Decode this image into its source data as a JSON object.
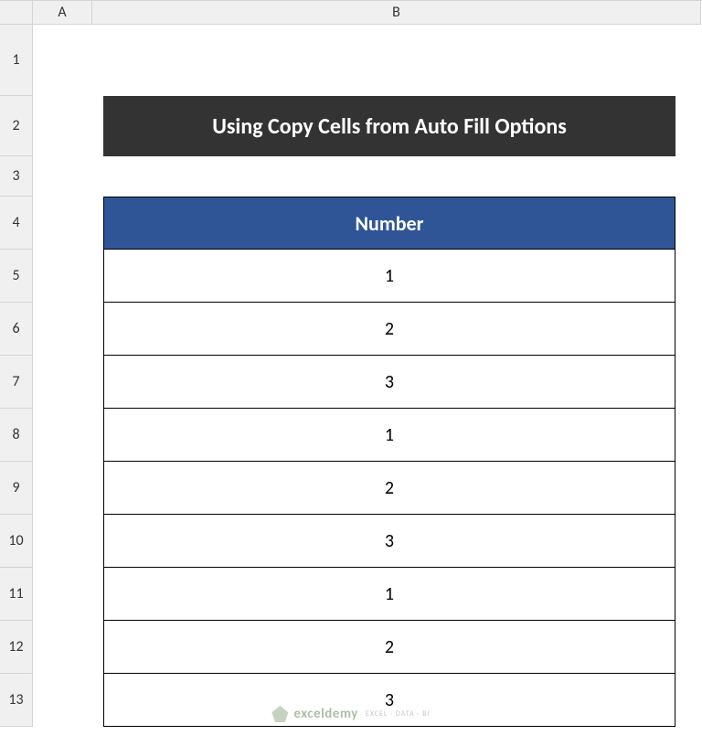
{
  "columns": {
    "corner": "",
    "A": "A",
    "B": "B"
  },
  "rows": [
    "1",
    "2",
    "3",
    "4",
    "5",
    "6",
    "7",
    "8",
    "9",
    "10",
    "11",
    "12",
    "13"
  ],
  "title": "Using Copy Cells from Auto Fill Options",
  "table": {
    "header": "Number",
    "values": [
      "1",
      "2",
      "3",
      "1",
      "2",
      "3",
      "1",
      "2",
      "3"
    ]
  },
  "watermark": {
    "brand": "exceldemy",
    "tagline": "EXCEL · DATA · BI"
  },
  "chart_data": {
    "type": "table",
    "title": "Using Copy Cells from Auto Fill Options",
    "columns": [
      "Number"
    ],
    "rows": [
      [
        1
      ],
      [
        2
      ],
      [
        3
      ],
      [
        1
      ],
      [
        2
      ],
      [
        3
      ],
      [
        1
      ],
      [
        2
      ],
      [
        3
      ]
    ]
  }
}
